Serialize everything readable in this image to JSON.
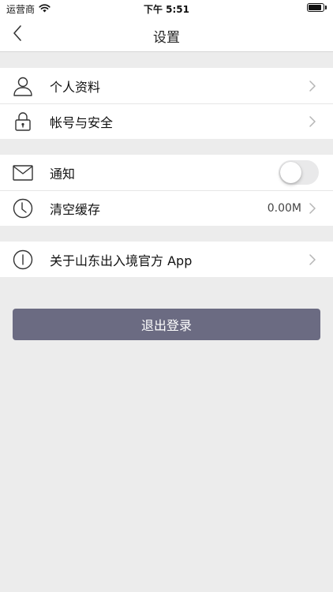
{
  "status_bar": {
    "carrier": "运营商",
    "time": "下午 5:51",
    "battery_level": 0.9
  },
  "nav": {
    "title": "设置",
    "back_icon": "chevron-left-icon"
  },
  "groups": [
    {
      "items": [
        {
          "label": "个人资料",
          "icon": "user-icon",
          "value": ""
        },
        {
          "label": "帐号与安全",
          "icon": "lock-icon",
          "value": ""
        }
      ]
    },
    {
      "items": [
        {
          "label": "通知",
          "icon": "mail-icon",
          "toggle_on": false
        },
        {
          "label": "清空缓存",
          "icon": "clock-icon",
          "value": "0.00M"
        }
      ]
    },
    {
      "items": [
        {
          "label": "关于山东出入境官方 App",
          "icon": "info-icon",
          "value": ""
        }
      ]
    }
  ],
  "logout": {
    "label": "退出登录"
  },
  "colors": {
    "background": "#ececec",
    "logout_button": "#6b6b82",
    "toggle_off": "#e9e9ea"
  }
}
